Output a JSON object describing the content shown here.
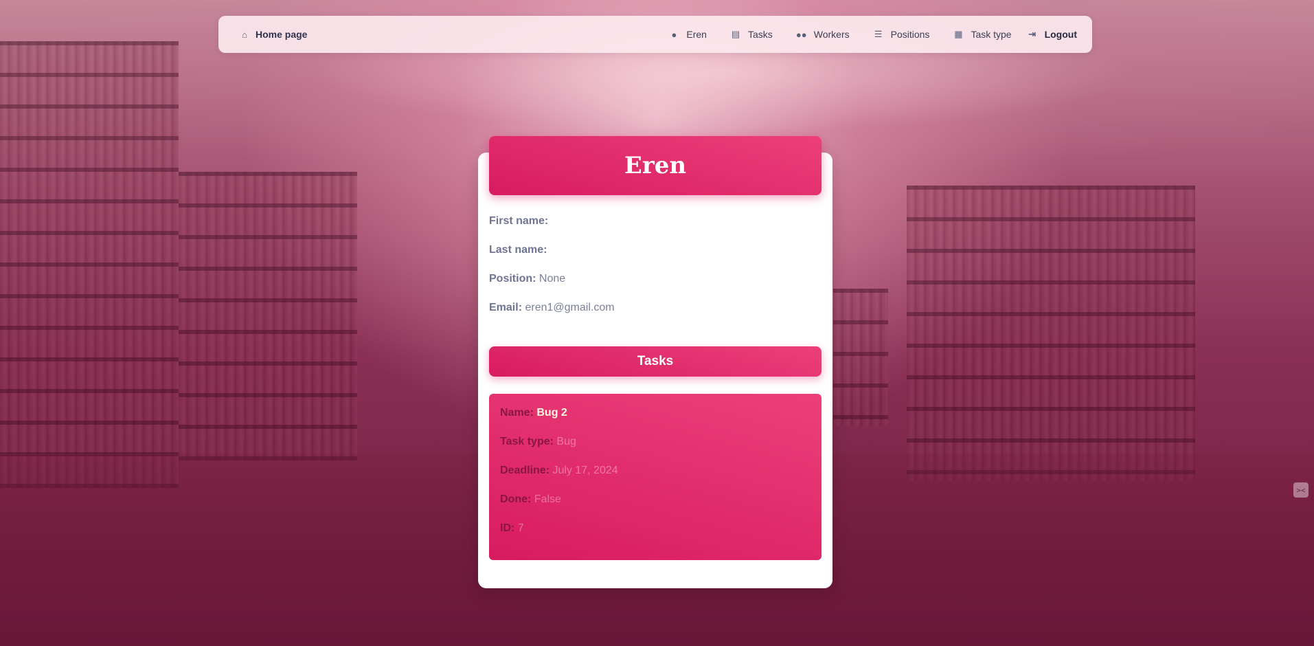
{
  "nav": {
    "home": {
      "label": "Home page",
      "icon": "home-icon"
    },
    "items": [
      {
        "label": "Eren",
        "icon": "person-icon"
      },
      {
        "label": "Tasks",
        "icon": "clipboard-icon"
      },
      {
        "label": "Workers",
        "icon": "group-icon"
      },
      {
        "label": "Positions",
        "icon": "list-icon"
      },
      {
        "label": "Task type",
        "icon": "dashboard-icon"
      }
    ],
    "logout": {
      "label": "Logout",
      "icon": "logout-icon"
    }
  },
  "profile": {
    "title": "Eren",
    "fields": [
      {
        "label": "First name:",
        "value": ""
      },
      {
        "label": "Last name:",
        "value": ""
      },
      {
        "label": "Position:",
        "value": "None"
      },
      {
        "label": "Email:",
        "value": "eren1@gmail.com"
      }
    ]
  },
  "tasks": {
    "heading": "Tasks",
    "items": [
      {
        "name_label": "Name:",
        "name": "Bug 2",
        "type_label": "Task type:",
        "type": "Bug",
        "deadline_label": "Deadline:",
        "deadline": "July 17, 2024",
        "done_label": "Done:",
        "done": "False",
        "id_label": "ID:",
        "id": "7"
      }
    ]
  },
  "colors": {
    "accent": "#e91e63",
    "accent_dark": "#d81b60",
    "text_muted": "#7b809a"
  }
}
